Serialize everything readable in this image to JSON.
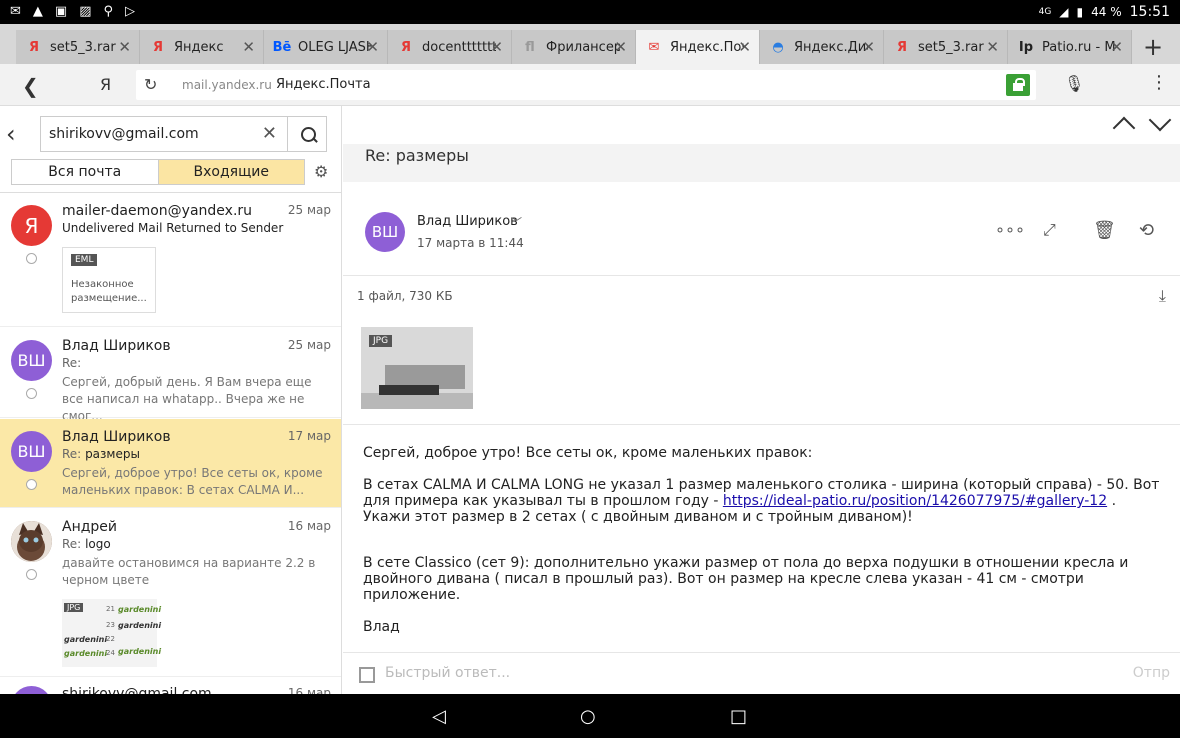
{
  "status": {
    "battery": "44 %",
    "time": "15:51",
    "net": "4G"
  },
  "tabs": [
    {
      "label": "set5_3.rar",
      "fav": "Я",
      "fav_color": "#e53935"
    },
    {
      "label": "Яндекс",
      "fav": "Я",
      "fav_color": "#e53935"
    },
    {
      "label": "OLEG LJASH",
      "fav": "Bē",
      "fav_color": "#0057ff"
    },
    {
      "label": "docenttttttt",
      "fav": "Я",
      "fav_color": "#e53935"
    },
    {
      "label": "Фрилансер",
      "fav": "fl",
      "fav_color": "#999999"
    },
    {
      "label": "Яндекс.Почта",
      "fav": "✉",
      "fav_color": "#e53935"
    },
    {
      "label": "Яндекс.Диск",
      "fav": "◓",
      "fav_color": "#2a7de1"
    },
    {
      "label": "set5_3.rar",
      "fav": "Я",
      "fav_color": "#e53935"
    },
    {
      "label": "Patio.ru - M",
      "fav": "Ip",
      "fav_color": "#222222"
    }
  ],
  "address": {
    "domain": "mail.yandex.ru",
    "title": "Яндекс.Почта",
    "ya": "Я"
  },
  "search": {
    "value": "shirikovv@gmail.com"
  },
  "filters": {
    "all": "Вся почта",
    "inbox": "Входящие"
  },
  "messages": [
    {
      "from": "mailer-daemon@yandex.ru",
      "date": "25 мар",
      "subject": "Undelivered Mail Returned to Sender",
      "avatar": "Я",
      "attachment": {
        "type": "EML",
        "name": "Незаконное размещение..."
      }
    },
    {
      "from": "Влад Шириков",
      "date": "25 мар",
      "re": "Re:",
      "subject": "",
      "avatar": "ВШ",
      "preview": "Сергей, добрый день. Я Вам вчера еще все написал на whatapp.. Вчера же не смог..."
    },
    {
      "from": "Влад Шириков",
      "date": "17 мар",
      "re": "Re:",
      "subject": "размеры",
      "avatar": "ВШ",
      "preview": "Сергей, доброе утро! Все сеты ок, кроме маленьких правок: В сетах CALMA И..."
    },
    {
      "from": "Андрей",
      "date": "16 мар",
      "re": "Re:",
      "subject": "logo",
      "avatar": "",
      "preview": "давайте остановимся на варианте 2.2 в черном цвете",
      "attach_type": "JPG"
    },
    {
      "from": "shirikovv@gmail.com",
      "date": "16 мар"
    }
  ],
  "logo_text": "gardenini",
  "logo_nums": [
    "21",
    "23",
    "22",
    "24"
  ],
  "email": {
    "subject": "Re: размеры",
    "sender": "Влад Шириков",
    "sender_initials": "ВШ",
    "date": "17 марта в 11:44",
    "files": "1 файл, 730 КБ",
    "attach_type": "JPG",
    "p1": "Сергей, доброе утро!  Все сеты ок, кроме маленьких правок:",
    "p2a": "В сетах CALMA  И CALMA LONG не указал 1 размер маленького столика - ширина (который справа) - 50. Вот для примера как указывал ты в прошлом году - ",
    "p2link": "https://ideal-patio.ru/position/1426077975/#gallery-12",
    "p2b": " . Укажи этот размер в 2 сетах ( с двойным диваном и с тройным диваном)!",
    "p3": "В сете Classico (сет 9): дополнительно укажи размер от пола до верха подушки в отношении кресла и двойного дивана ( писал в прошлый раз). Вот он размер на кресле слева указан - 41 см - смотри приложение.",
    "p4": "Влад"
  },
  "quick": {
    "placeholder": "Быстрый ответ...",
    "send": "Отпр"
  },
  "colors": {
    "accent": "#fbe8a7",
    "avatar_purple": "#8e5fd6",
    "yandex_red": "#e53935",
    "lock_green": "#3aa035"
  }
}
